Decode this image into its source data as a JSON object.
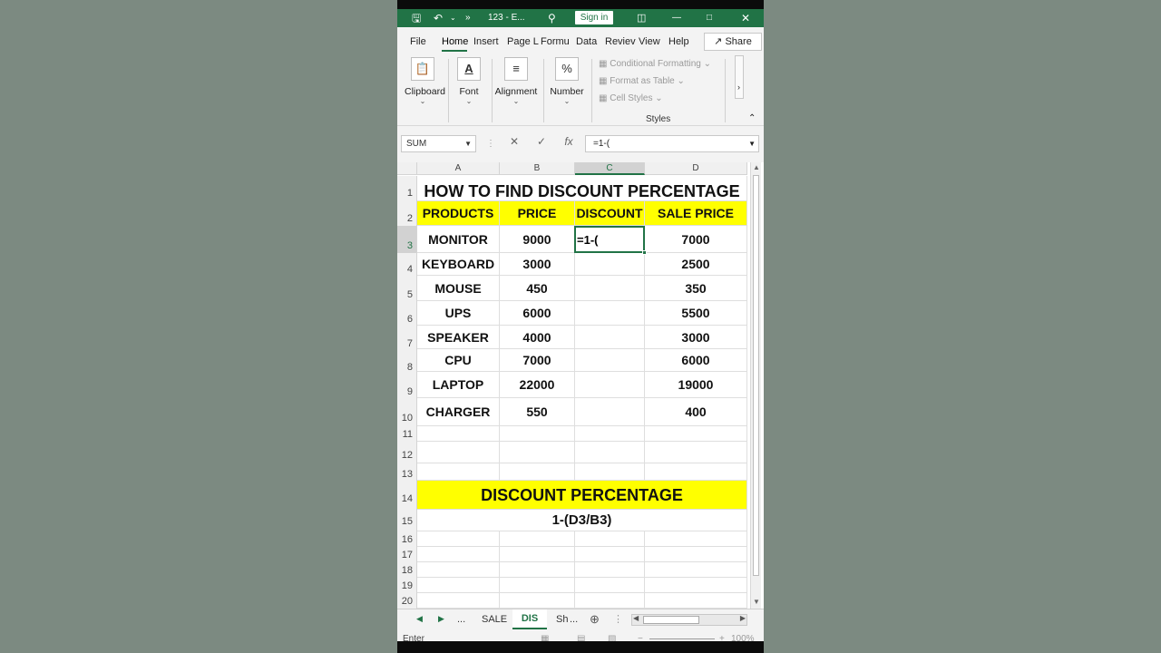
{
  "titlebar": {
    "title": "123 - E...",
    "sign_in": "Sign in",
    "more": "»"
  },
  "ribbon_tabs": [
    "File",
    "Home",
    "Insert",
    "Page L",
    "Formu",
    "Data",
    "Reviev",
    "View",
    "Help"
  ],
  "share_label": "Share",
  "ribbon_groups": {
    "clipboard": "Clipboard",
    "font": "Font",
    "alignment": "Alignment",
    "number": "Number",
    "number_icon": "%",
    "font_icon": "A",
    "conditional_formatting": "Conditional Formatting",
    "format_as_table": "Format as Table",
    "cell_styles": "Cell Styles",
    "styles": "Styles"
  },
  "formula_bar": {
    "name_box": "SUM",
    "formula": "=1-("
  },
  "columns": [
    "A",
    "B",
    "C",
    "D"
  ],
  "rows": [
    "1",
    "2",
    "3",
    "4",
    "5",
    "6",
    "7",
    "8",
    "9",
    "10",
    "11",
    "12",
    "13",
    "14",
    "15",
    "16",
    "17",
    "18",
    "19",
    "20"
  ],
  "sheet": {
    "title": "HOW TO FIND DISCOUNT PERCENTAGE",
    "headers": [
      "PRODUCTS",
      "PRICE",
      "DISCOUNT",
      "SALE PRICE"
    ],
    "data": [
      [
        "MONITOR",
        "9000",
        "=1-(",
        "7000"
      ],
      [
        "KEYBOARD",
        "3000",
        "",
        "2500"
      ],
      [
        "MOUSE",
        "450",
        "",
        "350"
      ],
      [
        "UPS",
        "6000",
        "",
        "5500"
      ],
      [
        "SPEAKER",
        "4000",
        "",
        "3000"
      ],
      [
        "CPU",
        "7000",
        "",
        "6000"
      ],
      [
        "LAPTOP",
        "22000",
        "",
        "19000"
      ],
      [
        "CHARGER",
        "550",
        "",
        "400"
      ]
    ],
    "percentage_label": "DISCOUNT PERCENTAGE",
    "percentage_formula": "1-(D3/B3)"
  },
  "sheet_tabs": {
    "more_left": "...",
    "tab1": "SALE",
    "tab_active": "DIS",
    "tab3": "Sh",
    "more_right": "..."
  },
  "status": {
    "mode": "Enter",
    "zoom": "100%"
  },
  "colors": {
    "excel_green": "#217346",
    "highlight_yellow": "#ffff00"
  }
}
